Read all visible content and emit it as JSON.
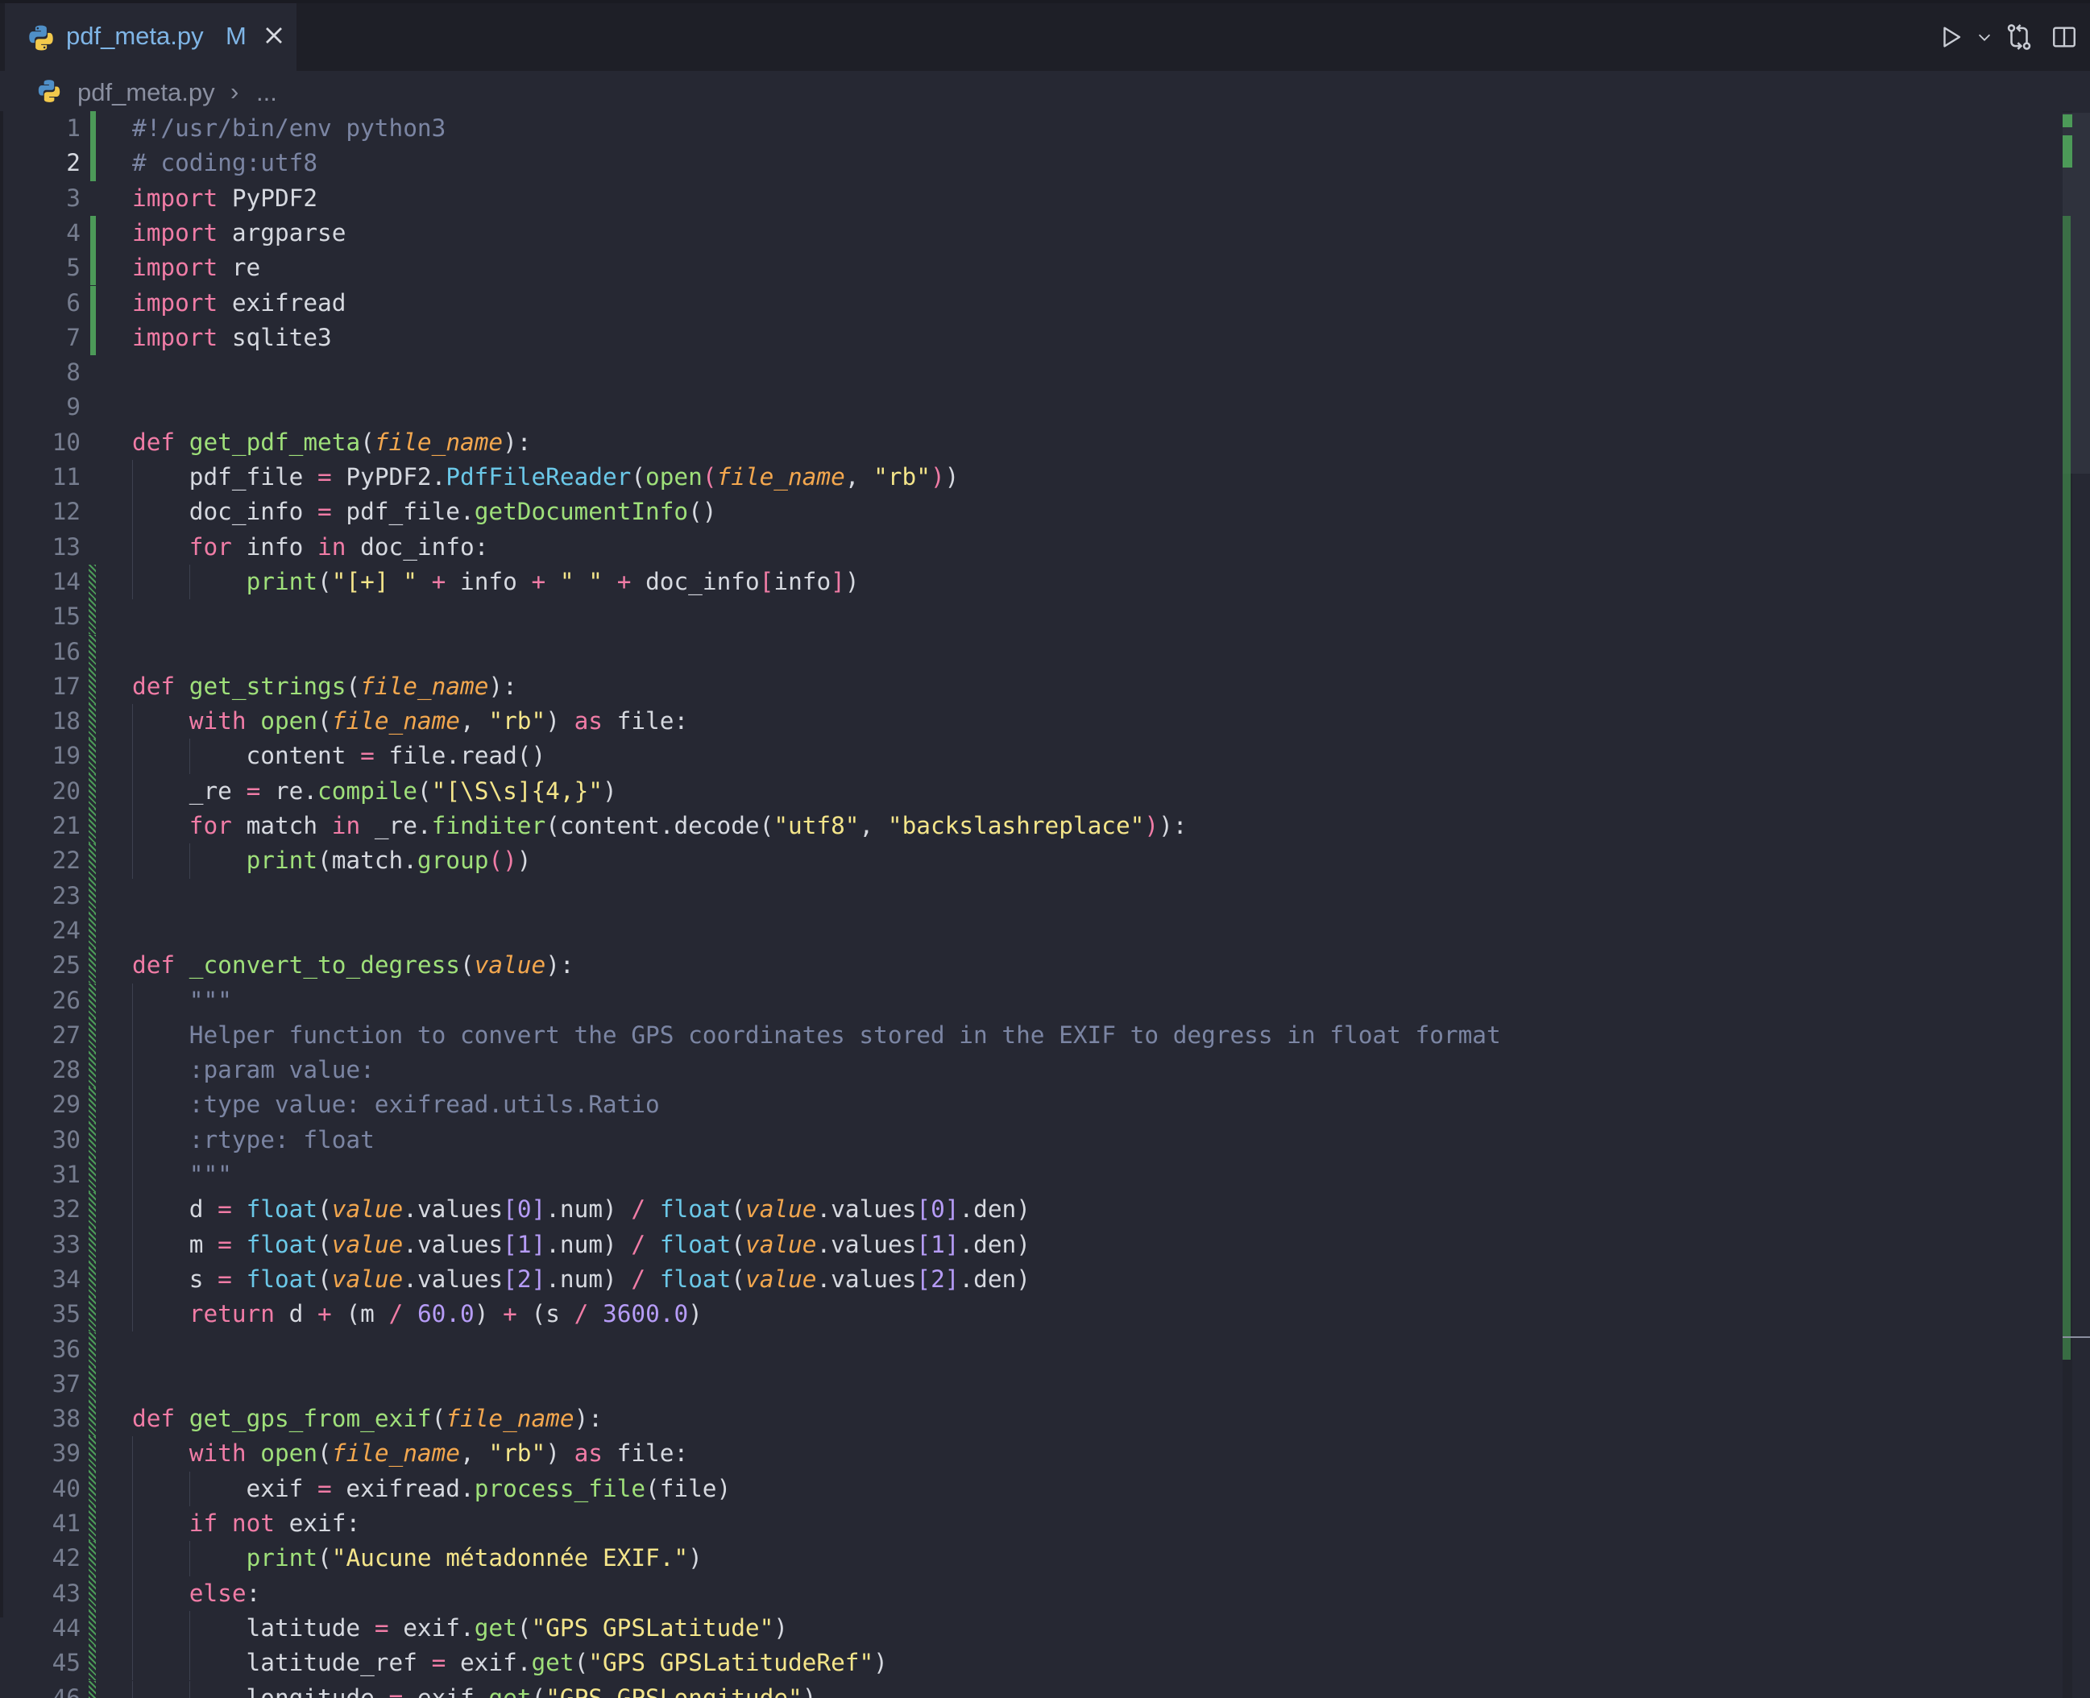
{
  "tab": {
    "filename": "pdf_meta.py",
    "status": "M"
  },
  "breadcrumb": {
    "file": "pdf_meta.py",
    "separator": "›",
    "more": "..."
  },
  "icons": {
    "file": "python-icon",
    "close": "close-icon",
    "run": "run-icon",
    "run_menu": "chevron-down-icon",
    "source_control": "open-changes-icon",
    "split": "split-editor-icon",
    "more": "more-actions-icon"
  },
  "colors": {
    "background": "#262833",
    "keyword": "#f07ca6",
    "function": "#9fe07a",
    "string": "#f4e58a",
    "comment": "#7b85a3",
    "parameter": "#f3a74e",
    "number": "#b69cf7",
    "git_added": "#4c9a58"
  },
  "code": {
    "lines": [
      [
        [
          "c",
          "#!/usr/bin/env python3"
        ]
      ],
      [
        [
          "c",
          "# coding:utf8"
        ]
      ],
      [
        [
          "k",
          "import"
        ],
        [
          "t",
          " PyPDF2"
        ]
      ],
      [
        [
          "k",
          "import"
        ],
        [
          "t",
          " argparse"
        ]
      ],
      [
        [
          "k",
          "import"
        ],
        [
          "t",
          " re"
        ]
      ],
      [
        [
          "k",
          "import"
        ],
        [
          "t",
          " exifread"
        ]
      ],
      [
        [
          "k",
          "import"
        ],
        [
          "t",
          " sqlite3"
        ]
      ],
      [],
      [],
      [
        [
          "k",
          "def"
        ],
        [
          "t",
          " "
        ],
        [
          "f",
          "get_pdf_meta"
        ],
        [
          "t",
          "("
        ],
        [
          "p",
          "file_name"
        ],
        [
          "t",
          "):"
        ]
      ],
      [
        [
          "t",
          "    pdf_file "
        ],
        [
          "op",
          "="
        ],
        [
          "t",
          " PyPDF2."
        ],
        [
          "cl",
          "PdfFileReader"
        ],
        [
          "t",
          "("
        ],
        [
          "f",
          "open"
        ],
        [
          "br2",
          "("
        ],
        [
          "p",
          "file_name"
        ],
        [
          "t",
          ", "
        ],
        [
          "s",
          "\"rb\""
        ],
        [
          "br2",
          ")"
        ],
        [
          "t",
          ")"
        ]
      ],
      [
        [
          "t",
          "    doc_info "
        ],
        [
          "op",
          "="
        ],
        [
          "t",
          " pdf_file."
        ],
        [
          "f",
          "getDocumentInfo"
        ],
        [
          "t",
          "()"
        ]
      ],
      [
        [
          "t",
          "    "
        ],
        [
          "k",
          "for"
        ],
        [
          "t",
          " info "
        ],
        [
          "k",
          "in"
        ],
        [
          "t",
          " doc_info:"
        ]
      ],
      [
        [
          "t",
          "        "
        ],
        [
          "f",
          "print"
        ],
        [
          "t",
          "("
        ],
        [
          "s",
          "\"[+] \""
        ],
        [
          "t",
          " "
        ],
        [
          "op",
          "+"
        ],
        [
          "t",
          " info "
        ],
        [
          "op",
          "+"
        ],
        [
          "t",
          " "
        ],
        [
          "s",
          "\" \""
        ],
        [
          "t",
          " "
        ],
        [
          "op",
          "+"
        ],
        [
          "t",
          " doc_info"
        ],
        [
          "br2",
          "["
        ],
        [
          "t",
          "info"
        ],
        [
          "br2",
          "]"
        ],
        [
          "t",
          ")"
        ]
      ],
      [],
      [],
      [
        [
          "k",
          "def"
        ],
        [
          "t",
          " "
        ],
        [
          "f",
          "get_strings"
        ],
        [
          "t",
          "("
        ],
        [
          "p",
          "file_name"
        ],
        [
          "t",
          "):"
        ]
      ],
      [
        [
          "t",
          "    "
        ],
        [
          "k",
          "with"
        ],
        [
          "t",
          " "
        ],
        [
          "f",
          "open"
        ],
        [
          "t",
          "("
        ],
        [
          "p",
          "file_name"
        ],
        [
          "t",
          ", "
        ],
        [
          "s",
          "\"rb\""
        ],
        [
          "t",
          ") "
        ],
        [
          "k",
          "as"
        ],
        [
          "t",
          " file:"
        ]
      ],
      [
        [
          "t",
          "        content "
        ],
        [
          "op",
          "="
        ],
        [
          "t",
          " file.read()"
        ]
      ],
      [
        [
          "t",
          "    _re "
        ],
        [
          "op",
          "="
        ],
        [
          "t",
          " re."
        ],
        [
          "f",
          "compile"
        ],
        [
          "t",
          "("
        ],
        [
          "s",
          "\"[\\S\\s]{4,}\""
        ],
        [
          "t",
          ")"
        ]
      ],
      [
        [
          "t",
          "    "
        ],
        [
          "k",
          "for"
        ],
        [
          "t",
          " match "
        ],
        [
          "k",
          "in"
        ],
        [
          "t",
          " _re."
        ],
        [
          "f",
          "finditer"
        ],
        [
          "t",
          "(content.decode("
        ],
        [
          "s",
          "\"utf8\""
        ],
        [
          "t",
          ", "
        ],
        [
          "s",
          "\"backslashreplace\""
        ],
        [
          "br2",
          ")"
        ],
        [
          "t",
          "):"
        ]
      ],
      [
        [
          "t",
          "        "
        ],
        [
          "f",
          "print"
        ],
        [
          "t",
          "(match."
        ],
        [
          "f",
          "group"
        ],
        [
          "br2",
          "()"
        ],
        [
          "t",
          ")"
        ]
      ],
      [],
      [],
      [
        [
          "k",
          "def"
        ],
        [
          "t",
          " "
        ],
        [
          "f",
          "_convert_to_degress"
        ],
        [
          "t",
          "("
        ],
        [
          "p",
          "value"
        ],
        [
          "t",
          "):"
        ]
      ],
      [
        [
          "c",
          "    \"\"\""
        ]
      ],
      [
        [
          "c",
          "    Helper function to convert the GPS coordinates stored in the EXIF to degress in float format"
        ]
      ],
      [
        [
          "c",
          "    :param value:"
        ]
      ],
      [
        [
          "c",
          "    :type value: exifread.utils.Ratio"
        ]
      ],
      [
        [
          "c",
          "    :rtype: float"
        ]
      ],
      [
        [
          "c",
          "    \"\"\""
        ]
      ],
      [
        [
          "t",
          "    d "
        ],
        [
          "op",
          "="
        ],
        [
          "t",
          " "
        ],
        [
          "cl",
          "float"
        ],
        [
          "t",
          "("
        ],
        [
          "p",
          "value"
        ],
        [
          "t",
          ".values"
        ],
        [
          "br3",
          "["
        ],
        [
          "n",
          "0"
        ],
        [
          "br3",
          "]"
        ],
        [
          "t",
          ".num) "
        ],
        [
          "op",
          "/"
        ],
        [
          "t",
          " "
        ],
        [
          "cl",
          "float"
        ],
        [
          "t",
          "("
        ],
        [
          "p",
          "value"
        ],
        [
          "t",
          ".values"
        ],
        [
          "br3",
          "["
        ],
        [
          "n",
          "0"
        ],
        [
          "br3",
          "]"
        ],
        [
          "t",
          ".den)"
        ]
      ],
      [
        [
          "t",
          "    m "
        ],
        [
          "op",
          "="
        ],
        [
          "t",
          " "
        ],
        [
          "cl",
          "float"
        ],
        [
          "t",
          "("
        ],
        [
          "p",
          "value"
        ],
        [
          "t",
          ".values"
        ],
        [
          "br3",
          "["
        ],
        [
          "n",
          "1"
        ],
        [
          "br3",
          "]"
        ],
        [
          "t",
          ".num) "
        ],
        [
          "op",
          "/"
        ],
        [
          "t",
          " "
        ],
        [
          "cl",
          "float"
        ],
        [
          "t",
          "("
        ],
        [
          "p",
          "value"
        ],
        [
          "t",
          ".values"
        ],
        [
          "br3",
          "["
        ],
        [
          "n",
          "1"
        ],
        [
          "br3",
          "]"
        ],
        [
          "t",
          ".den)"
        ]
      ],
      [
        [
          "t",
          "    s "
        ],
        [
          "op",
          "="
        ],
        [
          "t",
          " "
        ],
        [
          "cl",
          "float"
        ],
        [
          "t",
          "("
        ],
        [
          "p",
          "value"
        ],
        [
          "t",
          ".values"
        ],
        [
          "br3",
          "["
        ],
        [
          "n",
          "2"
        ],
        [
          "br3",
          "]"
        ],
        [
          "t",
          ".num) "
        ],
        [
          "op",
          "/"
        ],
        [
          "t",
          " "
        ],
        [
          "cl",
          "float"
        ],
        [
          "t",
          "("
        ],
        [
          "p",
          "value"
        ],
        [
          "t",
          ".values"
        ],
        [
          "br3",
          "["
        ],
        [
          "n",
          "2"
        ],
        [
          "br3",
          "]"
        ],
        [
          "t",
          ".den)"
        ]
      ],
      [
        [
          "t",
          "    "
        ],
        [
          "k",
          "return"
        ],
        [
          "t",
          " d "
        ],
        [
          "op",
          "+"
        ],
        [
          "t",
          " (m "
        ],
        [
          "op",
          "/"
        ],
        [
          "t",
          " "
        ],
        [
          "n",
          "60.0"
        ],
        [
          "t",
          ") "
        ],
        [
          "op",
          "+"
        ],
        [
          "t",
          " (s "
        ],
        [
          "op",
          "/"
        ],
        [
          "t",
          " "
        ],
        [
          "n",
          "3600.0"
        ],
        [
          "t",
          ")"
        ]
      ],
      [],
      [],
      [
        [
          "k",
          "def"
        ],
        [
          "t",
          " "
        ],
        [
          "f",
          "get_gps_from_exif"
        ],
        [
          "t",
          "("
        ],
        [
          "p",
          "file_name"
        ],
        [
          "t",
          "):"
        ]
      ],
      [
        [
          "t",
          "    "
        ],
        [
          "k",
          "with"
        ],
        [
          "t",
          " "
        ],
        [
          "f",
          "open"
        ],
        [
          "t",
          "("
        ],
        [
          "p",
          "file_name"
        ],
        [
          "t",
          ", "
        ],
        [
          "s",
          "\"rb\""
        ],
        [
          "t",
          ") "
        ],
        [
          "k",
          "as"
        ],
        [
          "t",
          " file:"
        ]
      ],
      [
        [
          "t",
          "        exif "
        ],
        [
          "op",
          "="
        ],
        [
          "t",
          " exifread."
        ],
        [
          "f",
          "process_file"
        ],
        [
          "t",
          "(file)"
        ]
      ],
      [
        [
          "t",
          "    "
        ],
        [
          "k",
          "if"
        ],
        [
          "t",
          " "
        ],
        [
          "k",
          "not"
        ],
        [
          "t",
          " exif:"
        ]
      ],
      [
        [
          "t",
          "        "
        ],
        [
          "f",
          "print"
        ],
        [
          "t",
          "("
        ],
        [
          "s",
          "\"Aucune métadonnée EXIF.\""
        ],
        [
          "t",
          ")"
        ]
      ],
      [
        [
          "t",
          "    "
        ],
        [
          "k",
          "else"
        ],
        [
          "t",
          ":"
        ]
      ],
      [
        [
          "t",
          "        latitude "
        ],
        [
          "op",
          "="
        ],
        [
          "t",
          " exif."
        ],
        [
          "f",
          "get"
        ],
        [
          "t",
          "("
        ],
        [
          "s",
          "\"GPS GPSLatitude\""
        ],
        [
          "t",
          ")"
        ]
      ],
      [
        [
          "t",
          "        latitude_ref "
        ],
        [
          "op",
          "="
        ],
        [
          "t",
          " exif."
        ],
        [
          "f",
          "get"
        ],
        [
          "t",
          "("
        ],
        [
          "s",
          "\"GPS GPSLatitudeRef\""
        ],
        [
          "t",
          ")"
        ]
      ],
      [
        [
          "t",
          "        longitude "
        ],
        [
          "op",
          "="
        ],
        [
          "t",
          " exif."
        ],
        [
          "f",
          "get"
        ],
        [
          "t",
          "("
        ],
        [
          "s",
          "\"GPS GPSLongitude\""
        ],
        [
          "t",
          ")"
        ]
      ]
    ],
    "git": {
      "added_lines": [
        1,
        2,
        4,
        5,
        6,
        7
      ],
      "modified_lines": [
        14,
        15,
        16,
        17,
        18,
        19,
        20,
        21,
        22,
        23,
        24,
        25,
        26,
        27,
        28,
        29,
        30,
        31,
        32,
        33,
        34,
        35,
        36,
        37,
        38,
        39,
        40,
        41,
        42,
        43,
        44,
        45,
        46
      ]
    },
    "active_line": 2
  }
}
